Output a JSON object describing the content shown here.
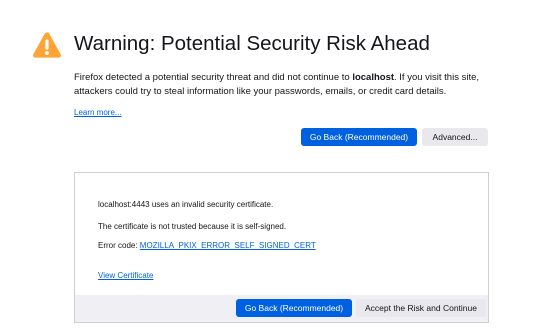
{
  "page": {
    "title": "Warning: Potential Security Risk Ahead",
    "description_pre": "Firefox detected a potential security threat and did not continue to ",
    "description_host": "localhost",
    "description_post": ". If you visit this site, attackers could try to steal information like your passwords, emails, or credit card details.",
    "learn_more": "Learn more...",
    "warning_icon": "warning-triangle-icon",
    "accent_color": "#0061e0",
    "warning_color": "#ffa436"
  },
  "actions": {
    "go_back": "Go Back (Recommended)",
    "advanced": "Advanced..."
  },
  "advanced_panel": {
    "invalid_cert": "localhost:4443 uses an invalid security certificate.",
    "not_trusted": "The certificate is not trusted because it is self-signed.",
    "error_code_label": "Error code: ",
    "error_code": "MOZILLA_PKIX_ERROR_SELF_SIGNED_CERT",
    "view_certificate": "View Certificate",
    "go_back": "Go Back (Recommended)",
    "accept_risk": "Accept the Risk and Continue"
  }
}
